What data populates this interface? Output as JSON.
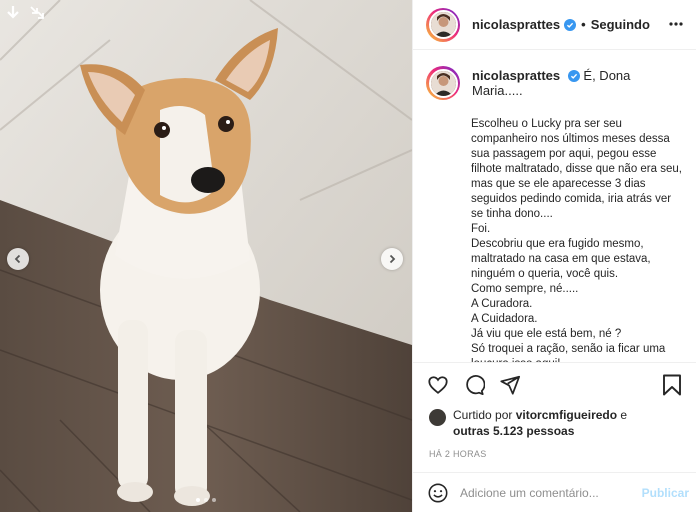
{
  "post": {
    "username": "nicolasprattes",
    "separator": "•",
    "follow_status": "Seguindo",
    "caption_opening": "É, Dona Maria.....",
    "caption_lines": [
      "Escolheu o Lucky pra ser seu companheiro nos últimos meses dessa sua passagem por aqui, pegou esse filhote maltratado, disse que não era seu, mas que se ele aparecesse 3 dias seguidos pedindo comida, iria atrás ver se tinha dono....",
      "Foi.",
      "Descobriu que era fugido mesmo, maltratado na casa em que estava, ninguém o queria, você quis.",
      "Como sempre, né.....",
      "A Curadora.",
      "A Cuidadora.",
      "Já viu que ele está bem, né ?",
      "Só troquei a ração, senão ia ficar uma loucura isso aqui!"
    ],
    "likes_prefix": "Curtido por",
    "liked_by_user": "vitorcmfigueiredo",
    "likes_joiner": "e",
    "likes_others": "outras 5.123 pessoas",
    "time_ago": "HÁ 2 HORAS"
  },
  "comment_box": {
    "placeholder": "Adicione um comentário...",
    "publish_label": "Publicar"
  },
  "carousel": {
    "total_slides": 3,
    "active_slide": 1
  },
  "icons": {
    "download": "download-arrow-icon",
    "expand": "expand-arrows-icon",
    "prev": "chevron-left-icon",
    "next": "chevron-right-icon",
    "verified": "verified-badge-icon",
    "more": "more-options-icon",
    "like": "heart-icon",
    "comment": "comment-bubble-icon",
    "share": "paper-plane-icon",
    "save": "bookmark-icon",
    "emoji": "smiley-icon"
  },
  "colors": {
    "verified_blue": "#3897f0",
    "publish_disabled": "#b2dffc",
    "muted_text": "#8e8e8e"
  }
}
